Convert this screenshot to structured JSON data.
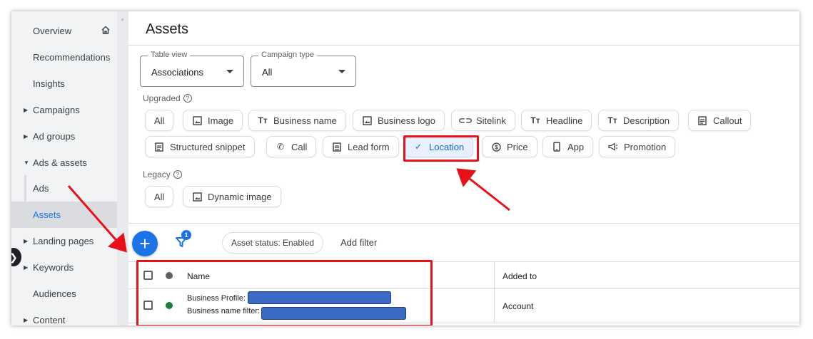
{
  "sidebar": {
    "items": [
      {
        "label": "Overview",
        "caret": ""
      },
      {
        "label": "Recommendations",
        "caret": ""
      },
      {
        "label": "Insights",
        "caret": ""
      },
      {
        "label": "Campaigns",
        "caret": "▶"
      },
      {
        "label": "Ad groups",
        "caret": "▶"
      },
      {
        "label": "Ads & assets",
        "caret": "▼"
      },
      {
        "label": "Ads",
        "caret": ""
      },
      {
        "label": "Assets",
        "caret": ""
      },
      {
        "label": "Landing pages",
        "caret": "▶"
      },
      {
        "label": "Keywords",
        "caret": "▶"
      },
      {
        "label": "Audiences",
        "caret": ""
      },
      {
        "label": "Content",
        "caret": "▶"
      }
    ],
    "active_item": "Assets",
    "home_icon": "home-icon"
  },
  "header": {
    "title": "Assets"
  },
  "filters": {
    "table_view": {
      "legend": "Table view",
      "value": "Associations"
    },
    "campaign_type": {
      "legend": "Campaign type",
      "value": "All"
    },
    "upgraded_label": "Upgraded",
    "upgraded_chips": [
      {
        "label": "All",
        "icon": ""
      },
      {
        "label": "Image",
        "icon": "image-icon"
      },
      {
        "label": "Business name",
        "icon": "text-format-icon"
      },
      {
        "label": "Business logo",
        "icon": "image-icon"
      },
      {
        "label": "Sitelink",
        "icon": "link-icon"
      },
      {
        "label": "Headline",
        "icon": "text-format-icon"
      },
      {
        "label": "Description",
        "icon": "text-format-icon"
      },
      {
        "label": "Callout",
        "icon": "document-icon"
      },
      {
        "label": "Structured snippet",
        "icon": "document-icon"
      },
      {
        "label": "Call",
        "icon": "phone-icon"
      },
      {
        "label": "Lead form",
        "icon": "list-icon"
      },
      {
        "label": "Location",
        "icon": "check-icon",
        "selected": true
      },
      {
        "label": "Price",
        "icon": "dollar-icon"
      },
      {
        "label": "App",
        "icon": "mobile-icon"
      },
      {
        "label": "Promotion",
        "icon": "megaphone-icon"
      }
    ],
    "legacy_label": "Legacy",
    "legacy_chips": [
      {
        "label": "All",
        "icon": ""
      },
      {
        "label": "Dynamic image",
        "icon": "image-icon"
      }
    ]
  },
  "toolbar": {
    "add_icon": "plus-icon",
    "filter_icon": "filter-icon",
    "filter_badge": "1",
    "status_chip": "Asset status: Enabled",
    "add_filter": "Add filter"
  },
  "table": {
    "columns": [
      "Name",
      "Added to"
    ],
    "rows": [
      {
        "line1": "Business Profile:",
        "line2": "Business name filter:",
        "added_to": "Account",
        "status_color": "#188038"
      }
    ],
    "header_status_color": "#5f6368"
  },
  "colors": {
    "accent": "#1a73e8",
    "annotation": "#e8111a",
    "selected_chip_bg": "#e8f0fe"
  }
}
